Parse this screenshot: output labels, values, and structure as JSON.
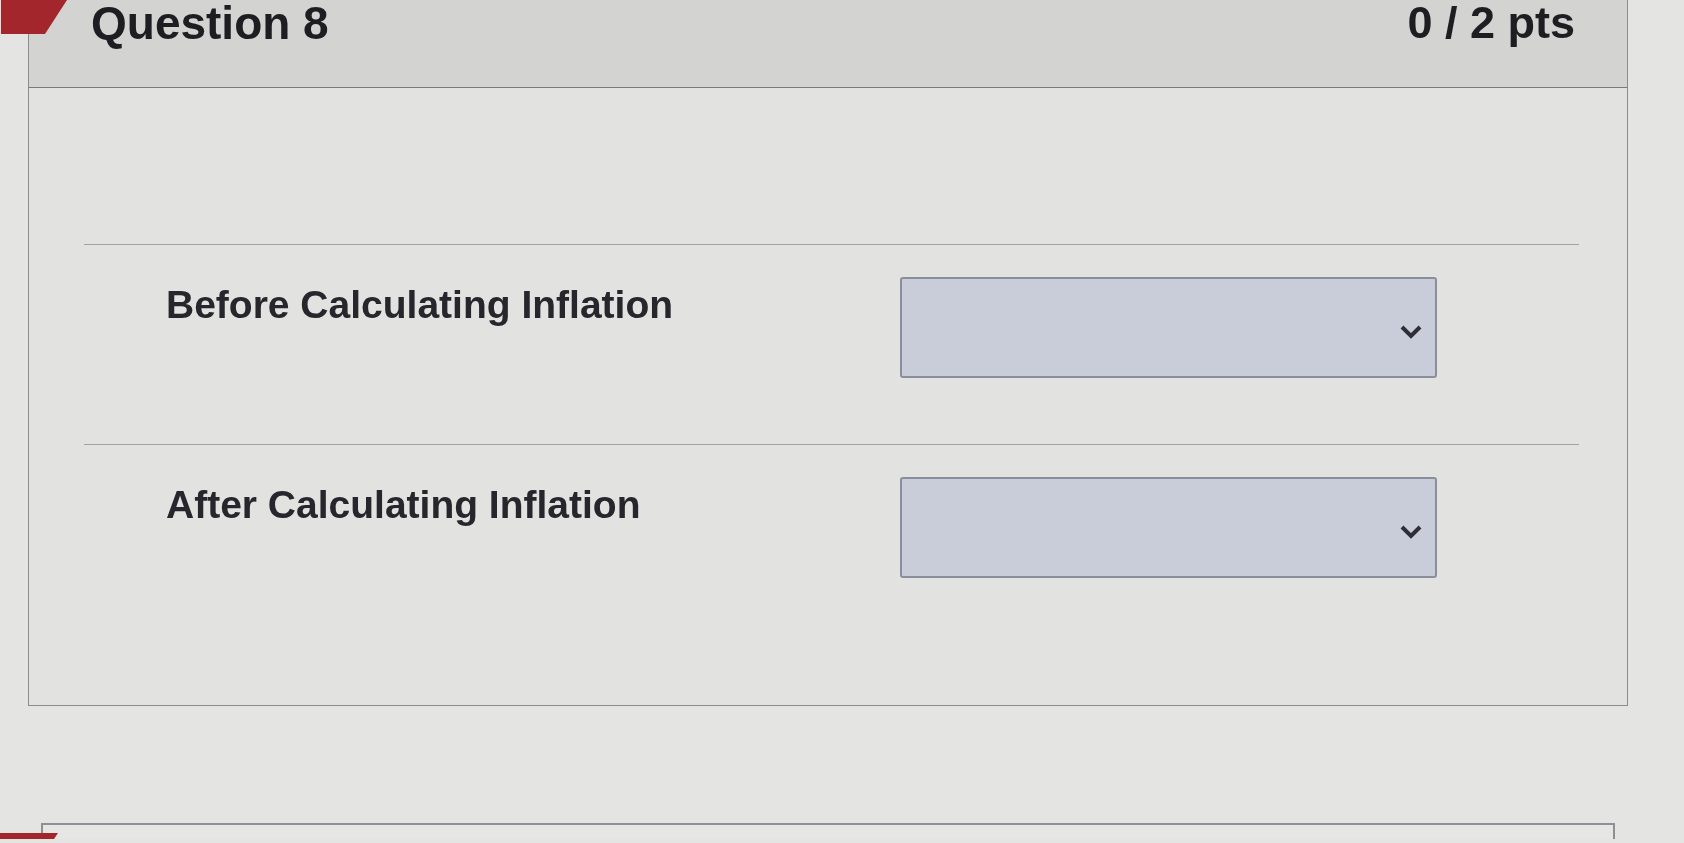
{
  "question": {
    "title": "Question 8",
    "points": "0 / 2 pts",
    "incorrect": true,
    "answers": [
      {
        "label": "Before Calculating Inflation"
      },
      {
        "label": "After Calculating Inflation"
      }
    ]
  },
  "next_question": {
    "incorrect": true
  }
}
